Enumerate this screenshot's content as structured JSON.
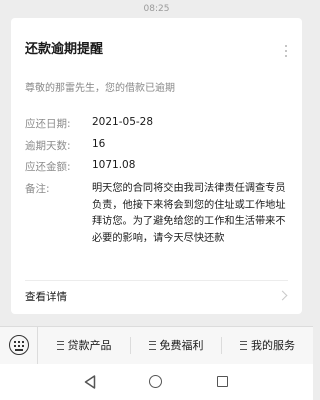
{
  "status_bar": {
    "time": "08:25"
  },
  "card": {
    "title": "还款逾期提醒",
    "subtitle": "尊敬的那雷先生，您的借款已逾期",
    "fields": [
      {
        "label": "应还日期:",
        "value": "2021-05-28"
      },
      {
        "label": "逾期天数:",
        "value": "16"
      },
      {
        "label": "应还金额:",
        "value": "1071.08"
      }
    ],
    "note_label": "备注:",
    "note_text": "明天您的合同将交由我司法律责任调查专员负责，他接下来将会到您的住址或工作地址拜访您。为了避免给您的工作和生活带来不必要的影响，请今天尽快还款",
    "details_label": "查看详情"
  },
  "menu": {
    "items": [
      {
        "label": "贷款产品"
      },
      {
        "label": "免费福利"
      },
      {
        "label": "我的服务"
      }
    ]
  },
  "icons": {
    "more": "more-vertical-icon",
    "chevron": "chevron-right-icon",
    "keyboard": "keyboard-icon",
    "menu_lines": "lines-icon",
    "back": "back-icon",
    "home": "home-icon",
    "recents": "recents-icon"
  }
}
